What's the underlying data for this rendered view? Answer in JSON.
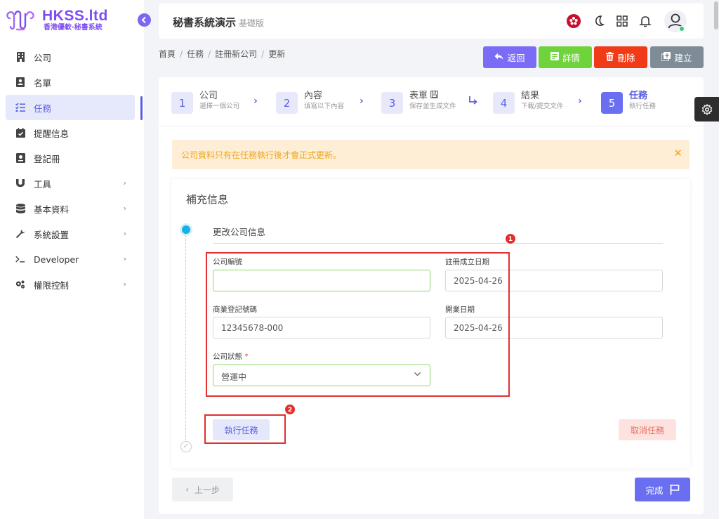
{
  "brand": {
    "title": "HKSS.ltd",
    "subtitle": "香港優軟·秘書系統",
    "accent": "#7d4df0"
  },
  "sidebar": {
    "items": [
      {
        "label": "公司",
        "icon": "building-icon"
      },
      {
        "label": "名單",
        "icon": "contact-card-icon"
      },
      {
        "label": "任務",
        "icon": "task-list-icon",
        "active": true
      },
      {
        "label": "提醒信息",
        "icon": "calendar-check-icon"
      },
      {
        "label": "登記冊",
        "icon": "register-book-icon"
      },
      {
        "label": "工具",
        "icon": "magnet-icon",
        "has_children": true
      },
      {
        "label": "基本資料",
        "icon": "database-icon",
        "has_children": true
      },
      {
        "label": "系統設置",
        "icon": "wrench-icon",
        "has_children": true
      },
      {
        "label": "Developer",
        "icon": "terminal-icon",
        "has_children": true
      },
      {
        "label": "權限控制",
        "icon": "cogs-icon",
        "has_children": true
      }
    ]
  },
  "header": {
    "title": "秘書系統演示",
    "version": "基礎版"
  },
  "breadcrumb": [
    "首頁",
    "任務",
    "註冊新公司",
    "更新"
  ],
  "actions": {
    "back": "返回",
    "details": "詳情",
    "delete": "刪除",
    "create": "建立"
  },
  "steps": [
    {
      "num": "1",
      "title": "公司",
      "desc": "選擇一個公司"
    },
    {
      "num": "2",
      "title": "內容",
      "desc": "填寫以下內容"
    },
    {
      "num": "3",
      "title": "表單",
      "desc": "保存並生成文件"
    },
    {
      "num": "4",
      "title": "結果",
      "desc": "下載/提交文件"
    },
    {
      "num": "5",
      "title": "任務",
      "desc": "執行任務"
    }
  ],
  "alert": {
    "text": "公司資料只有在任務執行後才會正式更新。"
  },
  "form": {
    "card_title": "補充信息",
    "section_title": "更改公司信息",
    "company_no_label": "公司編號",
    "company_no_value": "",
    "incorp_date_label": "註冊成立日期",
    "incorp_date_value": "2025-04-26",
    "br_no_label": "商業登記號碼",
    "br_no_value": "12345678-000",
    "open_date_label": "開業日期",
    "open_date_value": "2025-04-26",
    "status_label": "公司狀態",
    "status_required_mark": "*",
    "status_value": "營運中"
  },
  "annotations": {
    "badge1": "1",
    "badge2": "2"
  },
  "buttons": {
    "run_task": "執行任務",
    "cancel_task": "取消任務",
    "prev": "上一步",
    "finish": "完成"
  },
  "colors": {
    "primary": "#6a6ef0",
    "back_btn": "#7b6cf5",
    "details_btn": "#6fd33b",
    "delete_btn": "#f13a18",
    "create_btn": "#7f8c97",
    "alert_bg": "#fdeed5",
    "alert_text": "#f0a61e",
    "highlight": "#e0302f"
  }
}
